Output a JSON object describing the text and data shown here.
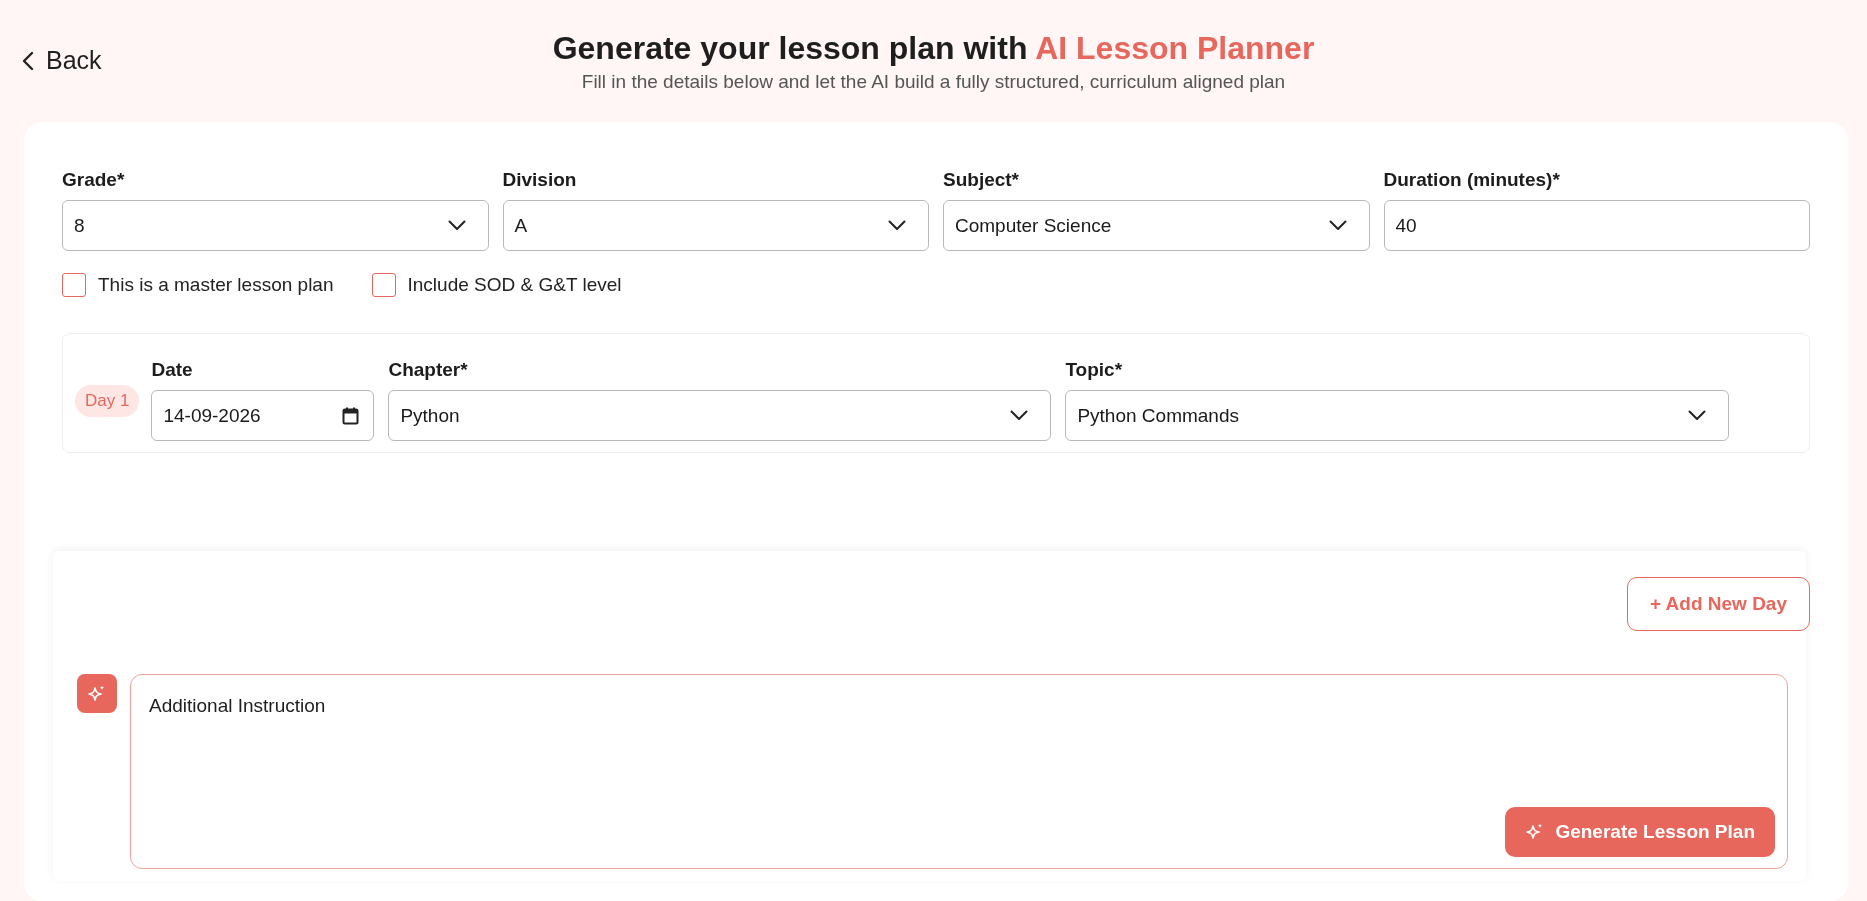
{
  "back": {
    "label": "Back"
  },
  "header": {
    "title": "Generate your lesson plan with",
    "title_highlight": "AI Lesson Planner",
    "subtitle": "Fill in the details below and let the AI build a fully structured, curriculum aligned plan"
  },
  "fields": [
    {
      "label": "Grade*",
      "value": "8",
      "kind": "select"
    },
    {
      "label": "Division",
      "value": "A",
      "kind": "select"
    },
    {
      "label": "Subject*",
      "value": "Computer Science",
      "kind": "select"
    },
    {
      "label": "Duration (minutes)*",
      "value": "40",
      "kind": "text"
    }
  ],
  "checkboxes": [
    {
      "label": "This is a master lesson plan",
      "checked": false
    },
    {
      "label": "Include SOD & G&T level",
      "checked": false
    }
  ],
  "days": [
    {
      "badge": "Day 1",
      "fields": [
        {
          "label": "Date",
          "value": "14-09-2026",
          "kind": "date"
        },
        {
          "label": "Chapter*",
          "value": "Python",
          "kind": "select"
        },
        {
          "label": "Topic*",
          "value": "Python Commands",
          "kind": "select"
        }
      ]
    }
  ],
  "add_day_button": "+ Add New Day",
  "instruction": {
    "placeholder": "Additional Instruction"
  },
  "generate_button": "Generate Lesson Plan"
}
